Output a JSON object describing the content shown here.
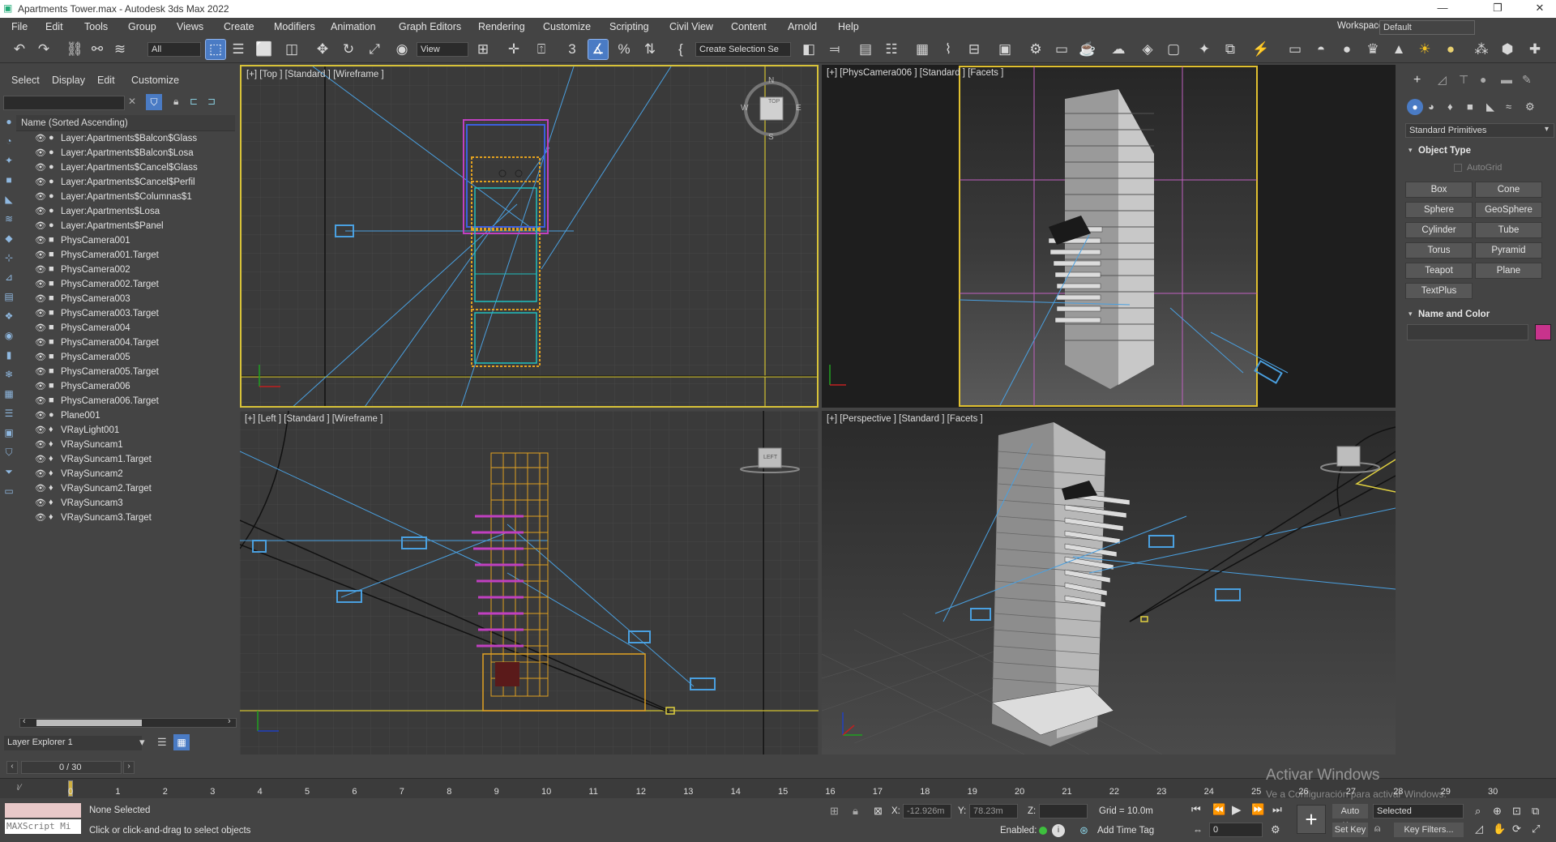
{
  "window": {
    "title": "Apartments Tower.max - Autodesk 3ds Max 2022",
    "workspaces_label": "Workspaces:",
    "workspace_value": "Default"
  },
  "menus": [
    "File",
    "Edit",
    "Tools",
    "Group",
    "Views",
    "Create",
    "Modifiers",
    "Animation",
    "Graph Editors",
    "Rendering",
    "Customize",
    "Scripting",
    "Civil View",
    "Content",
    "Arnold",
    "Help"
  ],
  "toolbar": {
    "filter_value": "All",
    "ref_coord_value": "View",
    "selection_set_placeholder": "Create Selection Se"
  },
  "explorer": {
    "tabs": [
      "Select",
      "Display",
      "Edit",
      "Customize"
    ],
    "column_header": "Name (Sorted Ascending)",
    "layers": [
      {
        "name": "Layer:Apartments$Balcon$Glass",
        "kind": "layer"
      },
      {
        "name": "Layer:Apartments$Balcon$Losa",
        "kind": "layer"
      },
      {
        "name": "Layer:Apartments$Cancel$Glass",
        "kind": "layer"
      },
      {
        "name": "Layer:Apartments$Cancel$Perfil",
        "kind": "layer"
      },
      {
        "name": "Layer:Apartments$Columnas$1",
        "kind": "layer"
      },
      {
        "name": "Layer:Apartments$Losa",
        "kind": "layer"
      },
      {
        "name": "Layer:Apartments$Panel",
        "kind": "layer"
      },
      {
        "name": "PhysCamera001",
        "kind": "camera"
      },
      {
        "name": "PhysCamera001.Target",
        "kind": "camera"
      },
      {
        "name": "PhysCamera002",
        "kind": "camera"
      },
      {
        "name": "PhysCamera002.Target",
        "kind": "camera"
      },
      {
        "name": "PhysCamera003",
        "kind": "camera"
      },
      {
        "name": "PhysCamera003.Target",
        "kind": "camera"
      },
      {
        "name": "PhysCamera004",
        "kind": "camera"
      },
      {
        "name": "PhysCamera004.Target",
        "kind": "camera"
      },
      {
        "name": "PhysCamera005",
        "kind": "camera"
      },
      {
        "name": "PhysCamera005.Target",
        "kind": "camera"
      },
      {
        "name": "PhysCamera006",
        "kind": "camera"
      },
      {
        "name": "PhysCamera006.Target",
        "kind": "camera"
      },
      {
        "name": "Plane001",
        "kind": "geo"
      },
      {
        "name": "VRayLight001",
        "kind": "light"
      },
      {
        "name": "VRaySuncam1",
        "kind": "light"
      },
      {
        "name": "VRaySuncam1.Target",
        "kind": "light"
      },
      {
        "name": "VRaySuncam2",
        "kind": "light"
      },
      {
        "name": "VRaySuncam2.Target",
        "kind": "light"
      },
      {
        "name": "VRaySuncam3",
        "kind": "light"
      },
      {
        "name": "VRaySuncam3.Target",
        "kind": "light"
      }
    ],
    "footer_label": "Layer Explorer 1"
  },
  "viewports": {
    "top": "[+] [Top ] [Standard ] [Wireframe ]",
    "camera": "[+] [PhysCamera006 ] [Standard ] [Facets ]",
    "left": "[+] [Left ] [Standard ] [Wireframe ]",
    "perspective": "[+] [Perspective ] [Standard ] [Facets ]",
    "viewcube_top": "TOP",
    "viewcube_left": "LEFT",
    "compass": {
      "n": "N",
      "s": "S",
      "e": "E",
      "w": "W"
    }
  },
  "command_panel": {
    "category": "Standard Primitives",
    "object_type_title": "Object Type",
    "autogrid": "AutoGrid",
    "buttons": [
      "Box",
      "Cone",
      "Sphere",
      "GeoSphere",
      "Cylinder",
      "Tube",
      "Torus",
      "Pyramid",
      "Teapot",
      "Plane",
      "TextPlus"
    ],
    "name_color_title": "Name and Color",
    "object_color": "#c8338c"
  },
  "timeline": {
    "frame_counter": "0 / 30",
    "ticks": [
      "0",
      "1",
      "2",
      "3",
      "4",
      "5",
      "6",
      "7",
      "8",
      "9",
      "10",
      "11",
      "12",
      "13",
      "14",
      "15",
      "16",
      "17",
      "18",
      "19",
      "20",
      "21",
      "22",
      "23",
      "24",
      "25",
      "26",
      "27",
      "28",
      "29",
      "30"
    ]
  },
  "status": {
    "maxscript": "MAXScript Mi",
    "selection": "None Selected",
    "prompt": "Click or click-and-drag to select objects",
    "x_label": "X:",
    "x_value": "-12.926m",
    "y_label": "Y:",
    "y_value": "78.23m",
    "z_label": "Z:",
    "grid": "Grid = 10.0m",
    "enabled": "Enabled:",
    "add_time_tag": "Add Time Tag",
    "auto_key": "Auto Key",
    "set_key": "Set Key",
    "selected_value": "Selected",
    "key_filters": "Key Filters...",
    "frame_value": "0",
    "watermark_title": "Activar Windows",
    "watermark_sub": "Ve a Configuración para activar Windows."
  }
}
